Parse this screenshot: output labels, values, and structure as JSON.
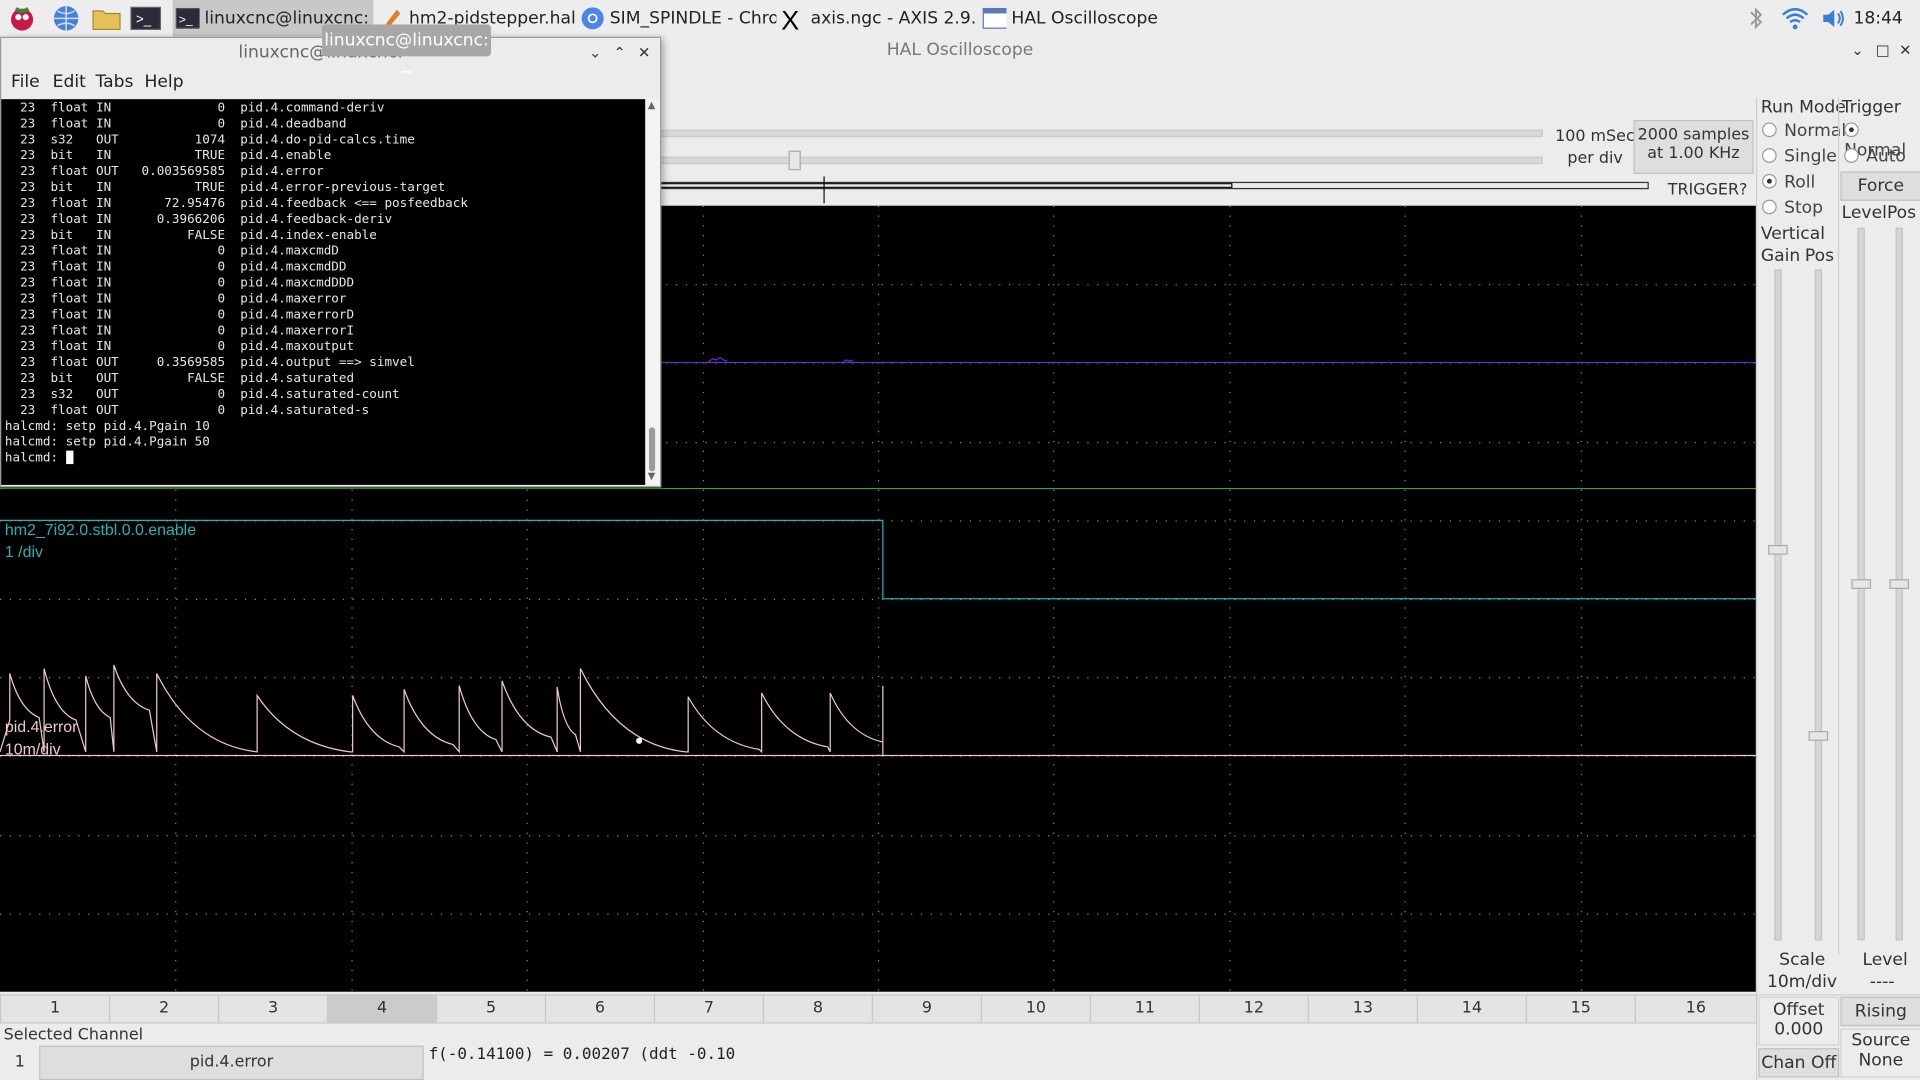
{
  "taskbar": {
    "tasks": [
      {
        "label": "linuxcnc@linuxcnc: ~"
      },
      {
        "label": "hm2-pidstepper.hal - ..."
      },
      {
        "label": "SIM_SPINDLE - Chro..."
      },
      {
        "label": "axis.ngc - AXIS 2.9.0..."
      },
      {
        "label": "HAL Oscilloscope"
      }
    ],
    "clock": "18:44"
  },
  "tooltip": "linuxcnc@linuxcnc: ~",
  "scope": {
    "window_title": "HAL Oscilloscope",
    "time_per_div": "100 mSec",
    "per_div": "per div",
    "samples_line1": "2000 samples",
    "samples_line2": "at 1.00 KHz",
    "trigger_status": "TRIGGER?",
    "run_mode_title": "Run Mode",
    "run_modes": [
      "Normal",
      "Single",
      "Roll",
      "Stop"
    ],
    "run_mode_selected": "Roll",
    "trigger_title": "Trigger",
    "trigger_modes": [
      "Normal",
      "Auto"
    ],
    "trigger_selected": "Normal",
    "force_label": "Force",
    "vertical_title": "Vertical",
    "gain_label": "Gain",
    "pos_label": "Pos",
    "level_label": "Level",
    "trig_pos_label": "Pos",
    "scale_label": "Scale",
    "scale_value": "10m/div",
    "offset_label": "Offset",
    "offset_value": "0.000",
    "chan_off_label": "Chan Off",
    "trig_level_label": "Level",
    "trig_level_value": "----",
    "edge_label": "Rising",
    "source_label": "Source",
    "source_value": "None",
    "trace1_name": "hm2_7i92.0.stbl.0.0.enable",
    "trace1_scale": "1 /div",
    "trace2_name": "pid.4.error",
    "trace2_scale": "10m/div",
    "channels": [
      "1",
      "2",
      "3",
      "4",
      "5",
      "6",
      "7",
      "8",
      "9",
      "10",
      "11",
      "12",
      "13",
      "14",
      "15",
      "16"
    ],
    "channel_selected": "4",
    "selected_channel_label": "Selected Channel",
    "selected_channel_num": "1",
    "selected_channel_name": "pid.4.error",
    "readout": "f(-0.14100) =  0.00207 (ddt -0.10"
  },
  "terminal": {
    "title": "linuxcnc@linuxcnc: ~",
    "menu": [
      "File",
      "Edit",
      "Tabs",
      "Help"
    ],
    "lines": [
      "  23  float IN              0  pid.4.command-deriv",
      "  23  float IN              0  pid.4.deadband",
      "  23  s32   OUT          1074  pid.4.do-pid-calcs.time",
      "  23  bit   IN           TRUE  pid.4.enable",
      "  23  float OUT   0.003569585  pid.4.error",
      "  23  bit   IN           TRUE  pid.4.error-previous-target",
      "  23  float IN       72.95476  pid.4.feedback <== posfeedback",
      "  23  float IN      0.3966206  pid.4.feedback-deriv",
      "  23  bit   IN          FALSE  pid.4.index-enable",
      "  23  float IN              0  pid.4.maxcmdD",
      "  23  float IN              0  pid.4.maxcmdDD",
      "  23  float IN              0  pid.4.maxcmdDDD",
      "  23  float IN              0  pid.4.maxerror",
      "  23  float IN              0  pid.4.maxerrorD",
      "  23  float IN              0  pid.4.maxerrorI",
      "  23  float IN              0  pid.4.maxoutput",
      "  23  float OUT     0.3569585  pid.4.output ==> simvel",
      "  23  bit   OUT         FALSE  pid.4.saturated",
      "  23  s32   OUT             0  pid.4.saturated-count",
      "  23  float OUT             0  pid.4.saturated-s",
      "",
      "halcmd: setp pid.4.Pgain 10",
      "halcmd: setp pid.4.Pgain 50",
      "halcmd: "
    ]
  },
  "colors": {
    "trace_enable": "#1fb5b5",
    "trace_error": "#f0c8c8",
    "trace_purple": "#6a2bd6",
    "grid_dot": "#8a8a8a"
  }
}
